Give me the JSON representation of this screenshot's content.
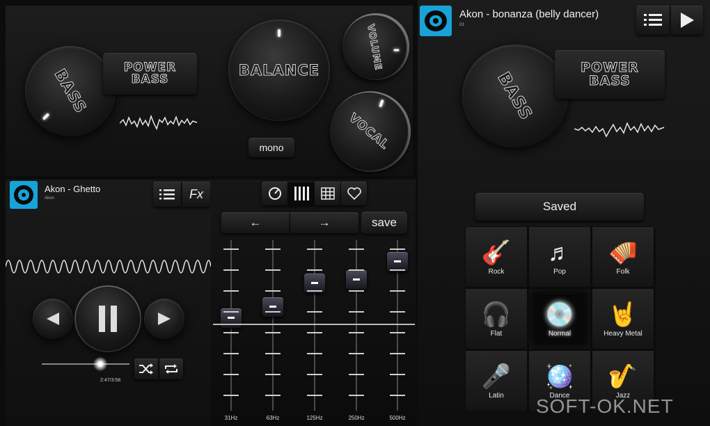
{
  "top_left": {
    "bass_knob_label": "BASS",
    "power_bass_line1": "POWER",
    "power_bass_line2": "BASS",
    "balance_label": "BALANCE",
    "volume_label": "VOLUME",
    "vocal_label": "VOCAL",
    "mono_label": "mono"
  },
  "right_player": {
    "title": "Akon - bonanza (belly dancer)",
    "subtitle": "03",
    "bass_knob_label": "BASS",
    "power_bass_line1": "POWER",
    "power_bass_line2": "BASS"
  },
  "left_player": {
    "title": "Akon - Ghetto",
    "subtitle": "Akon",
    "fx_label": "Fx",
    "time": "2:47/3:58"
  },
  "eq": {
    "prev_icon": "←",
    "next_icon": "→",
    "save_label": "save",
    "bands": [
      {
        "label": "31Hz",
        "level": 0.55
      },
      {
        "label": "63Hz",
        "level": 0.62
      },
      {
        "label": "125Hz",
        "level": 0.78
      },
      {
        "label": "250Hz",
        "level": 0.8
      },
      {
        "label": "500Hz",
        "level": 0.92
      }
    ]
  },
  "presets": {
    "saved_label": "Saved",
    "selected": "Normal",
    "items": [
      {
        "label": "Rock",
        "icon": "guitar-icon"
      },
      {
        "label": "Pop",
        "icon": "music-notes-icon"
      },
      {
        "label": "Folk",
        "icon": "accordion-icon"
      },
      {
        "label": "Flat",
        "icon": "headphones-icon"
      },
      {
        "label": "Normal",
        "icon": "disc-icon"
      },
      {
        "label": "Heavy Metal",
        "icon": "rock-hand-icon"
      },
      {
        "label": "Latin",
        "icon": "microphone-icon"
      },
      {
        "label": "Dance",
        "icon": "disco-ball-icon"
      },
      {
        "label": "Jazz",
        "icon": "saxophone-icon"
      }
    ]
  },
  "watermark": "SOFT-OK.NET",
  "colors": {
    "accent": "#17a3d8",
    "background": "#0c0c0c"
  }
}
